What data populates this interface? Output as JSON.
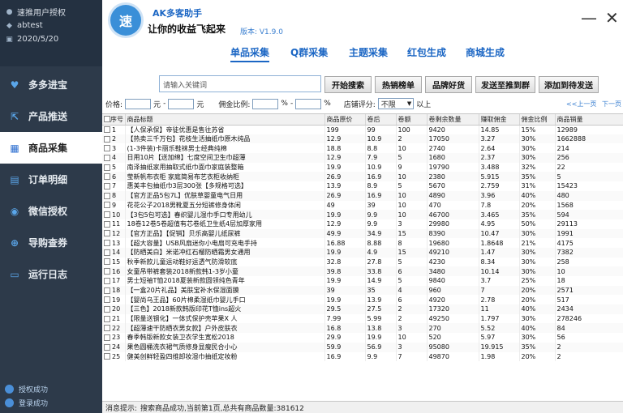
{
  "sidebar": {
    "user_rows": [
      {
        "icon": "user-icon",
        "text": "速推用户授权"
      },
      {
        "icon": "account-icon",
        "text": "abtest"
      },
      {
        "icon": "calendar-icon",
        "text": "2020/5/20"
      }
    ],
    "items": [
      {
        "icon": "heart-icon",
        "label": "多多进宝"
      },
      {
        "icon": "external-link-icon",
        "label": "产品推送"
      },
      {
        "icon": "grid-icon",
        "label": "商品采集"
      },
      {
        "icon": "document-icon",
        "label": "订单明细"
      },
      {
        "icon": "wechat-icon",
        "label": "微信授权"
      },
      {
        "icon": "shopping-bag-icon",
        "label": "导购查券"
      },
      {
        "icon": "terminal-icon",
        "label": "运行日志"
      }
    ],
    "active_index": 2,
    "status": [
      "授权成功",
      "登录成功"
    ]
  },
  "header": {
    "logo_text": "速",
    "title": "AK多客助手",
    "slogan": "让你的收益飞起来",
    "version": "版本: V1.9.0"
  },
  "tabs": [
    "单品采集",
    "Q群采集",
    "主题采集",
    "红包生成",
    "商城生成"
  ],
  "active_tab": 0,
  "toolbar": {
    "search_placeholder": "请输入关键词",
    "buttons": [
      "开始搜索",
      "热销榜单",
      "品牌好货",
      "发送至推到群",
      "添加到待发送"
    ]
  },
  "filter": {
    "price_label": "价格:",
    "yuan": "元",
    "dash": "-",
    "commission_label": "佣金比例:",
    "percent": "%",
    "score_label": "店铺评分:",
    "score_value": "不限",
    "score_suffix": "以上",
    "prev": "<<上一页",
    "next": "下一页"
  },
  "table": {
    "headers": [
      "序号",
      "商品标题",
      "商品原价",
      "卷后",
      "卷额",
      "卷剩余数量",
      "赚取佣金",
      "佣金比例",
      "商品销量"
    ],
    "rows": [
      [
        "1",
        "【人保承保】帝徒优惠是售往苏省",
        "199",
        "99",
        "100",
        "9420",
        "14.85",
        "15%",
        "12989"
      ],
      [
        "2",
        "【热卖三千万包】花枝生活抽纸巾原木纯品",
        "12.9",
        "10.9",
        "2",
        "17050",
        "3.27",
        "30%",
        "1662888"
      ],
      [
        "3",
        "(1-3件装)卡丽乐鞋袜男士经典纯棉",
        "18.8",
        "8.8",
        "10",
        "2740",
        "2.64",
        "30%",
        "214"
      ],
      [
        "4",
        "日用10片【送加绵】七度空间卫生巾超薄",
        "12.9",
        "7.9",
        "5",
        "1680",
        "2.37",
        "30%",
        "256"
      ],
      [
        "5",
        "南泽抽纸家用抽取式纸巾面巾家庭装整箱",
        "19.9",
        "10.9",
        "9",
        "19790",
        "3.488",
        "32%",
        "22"
      ],
      [
        "6",
        "莹新帆布衣柜 家庭简易布艺衣柜收纳柜",
        "26.9",
        "16.9",
        "10",
        "2380",
        "5.915",
        "35%",
        "5"
      ],
      [
        "7",
        "惠美丰包抽纸巾3层300张【多规格可选】",
        "13.9",
        "8.9",
        "5",
        "5670",
        "2.759",
        "31%",
        "15423"
      ],
      [
        "8",
        "【官方正品5包7L】优肤草婴童电气日用",
        "26.9",
        "16.9",
        "10",
        "4890",
        "3.96",
        "40%",
        "480"
      ],
      [
        "9",
        "花花公子2018男靴夏五分短裤修身体闲",
        "49",
        "39",
        "10",
        "470",
        "7.8",
        "20%",
        "1568"
      ],
      [
        "10",
        "【3包5包可选】春织婴儿湿巾手口专用幼儿",
        "19.9",
        "9.9",
        "10",
        "46700",
        "3.465",
        "35%",
        "594"
      ],
      [
        "11",
        "18卷12卷5卷超值有芯卷纸卫生纸4层加厚家用",
        "12.9",
        "9.9",
        "3",
        "29980",
        "4.95",
        "50%",
        "29113"
      ],
      [
        "12",
        "【官方正品】【促销】贝乐高婴儿纸尿裤",
        "49.9",
        "34.9",
        "15",
        "8390",
        "10.47",
        "30%",
        "1991"
      ],
      [
        "13",
        "【超大容量】USB风扇迷你小电扇可充电手持",
        "16.88",
        "8.88",
        "8",
        "19680",
        "1.8648",
        "21%",
        "4175"
      ],
      [
        "14",
        "【防晒美白】米诺冲红石榴防晒霜男女通用",
        "19.9",
        "4.9",
        "15",
        "49210",
        "1.47",
        "30%",
        "7382"
      ],
      [
        "15",
        "秋季新款儿童运动鞋好运透气防滑软底",
        "32.8",
        "27.8",
        "5",
        "4230",
        "8.34",
        "30%",
        "258"
      ],
      [
        "16",
        "女童吊带裤套装2018新款韩1-3岁小童",
        "39.8",
        "33.8",
        "6",
        "3480",
        "10.14",
        "30%",
        "10"
      ],
      [
        "17",
        "男士短袖T恤2018夏装新款圆领纯色青年",
        "19.9",
        "14.9",
        "5",
        "9840",
        "3.7",
        "25%",
        "18"
      ],
      [
        "18",
        "【一盒20片礼品】美肤宝补水保湿面膜",
        "39",
        "35",
        "4",
        "960",
        "7",
        "20%",
        "2571"
      ],
      [
        "19",
        "【婴尚乌王品】60片棉柔湿纸巾婴儿手口",
        "19.9",
        "13.9",
        "6",
        "4920",
        "2.78",
        "20%",
        "517"
      ],
      [
        "20",
        "【三色】2018新款韩版印花T恤ins超火",
        "29.5",
        "27.5",
        "2",
        "17320",
        "11",
        "40%",
        "2434"
      ],
      [
        "21",
        "【限量送钢化】一体式保护壳苹果X 人",
        "7.99",
        "5.99",
        "2",
        "49250",
        "1.797",
        "30%",
        "278246"
      ],
      [
        "22",
        "【超薄速干防晒衣男女款】户外皮肤衣",
        "16.8",
        "13.8",
        "3",
        "270",
        "5.52",
        "40%",
        "84"
      ],
      [
        "23",
        "春季韩版新款女装卫衣学生宽松2018",
        "29.9",
        "19.9",
        "10",
        "520",
        "5.97",
        "30%",
        "56"
      ],
      [
        "24",
        "果色圆桶洗衣裙气质修身显瘦民合小心",
        "59.9",
        "56.9",
        "3",
        "95080",
        "19.915",
        "35%",
        "2"
      ],
      [
        "25",
        "健美创鲜轻盈四维卸妆湿巾抽纸定妆粉",
        "16.9",
        "9.9",
        "7",
        "49870",
        "1.98",
        "20%",
        "2"
      ]
    ]
  },
  "statusbar": {
    "label": "消息提示:",
    "message": "搜索商品成功,当前第1页,总共有商品数量:381612"
  }
}
